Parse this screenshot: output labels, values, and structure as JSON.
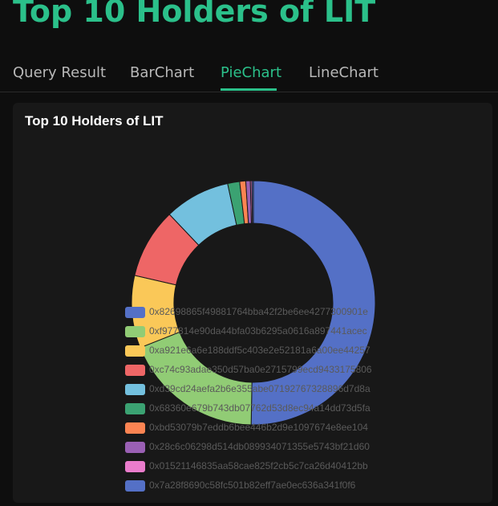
{
  "page_title": "Top 10 Holders of LIT",
  "tabs": [
    {
      "label": "Query Result",
      "active": false
    },
    {
      "label": "BarChart",
      "active": false
    },
    {
      "label": "PieChart",
      "active": true
    },
    {
      "label": "LineChart",
      "active": false
    }
  ],
  "chart_data": {
    "type": "pie",
    "donut": true,
    "title": "Top 10 Holders of LIT",
    "legend_position": "bottom-left",
    "series": [
      {
        "name": "0x82698865f49881764bba42f2be6ee4277300901e",
        "value": 50.3,
        "color": "#5470c6"
      },
      {
        "name": "0xf977814e90da44bfa03b6295a0616a897441acec",
        "value": 18.7,
        "color": "#91cc75"
      },
      {
        "name": "0xa921e6a6e188ddf5c403e2e52181a6a00ee44257",
        "value": 9.6,
        "color": "#fac858"
      },
      {
        "name": "0xc74c93adae350d57ba0e2715799ecd9433175806",
        "value": 9.3,
        "color": "#ee6666"
      },
      {
        "name": "0xd39cd24aefa2b6e355abe07192767328896d7d8a",
        "value": 8.7,
        "color": "#73c0de"
      },
      {
        "name": "0x68360e679b743db07762d53d8ec94a14dd73d5fa",
        "value": 1.6,
        "color": "#3ba272"
      },
      {
        "name": "0xbd53079b7eddb6bee446b2d9e1097674e8ee104",
        "value": 0.8,
        "color": "#fc8452"
      },
      {
        "name": "0x28c6c06298d514db089934071355e5743bf21d60",
        "value": 0.6,
        "color": "#9a60b4"
      },
      {
        "name": "0x01521146835aa58cae825f2cb5c7ca26d40412bb",
        "value": 0.2,
        "color": "#ea7ccc"
      },
      {
        "name": "0x7a28f8690c58fc501b82eff7ae0ec636a341f0f6",
        "value": 0.2,
        "color": "#5470c6"
      }
    ]
  }
}
